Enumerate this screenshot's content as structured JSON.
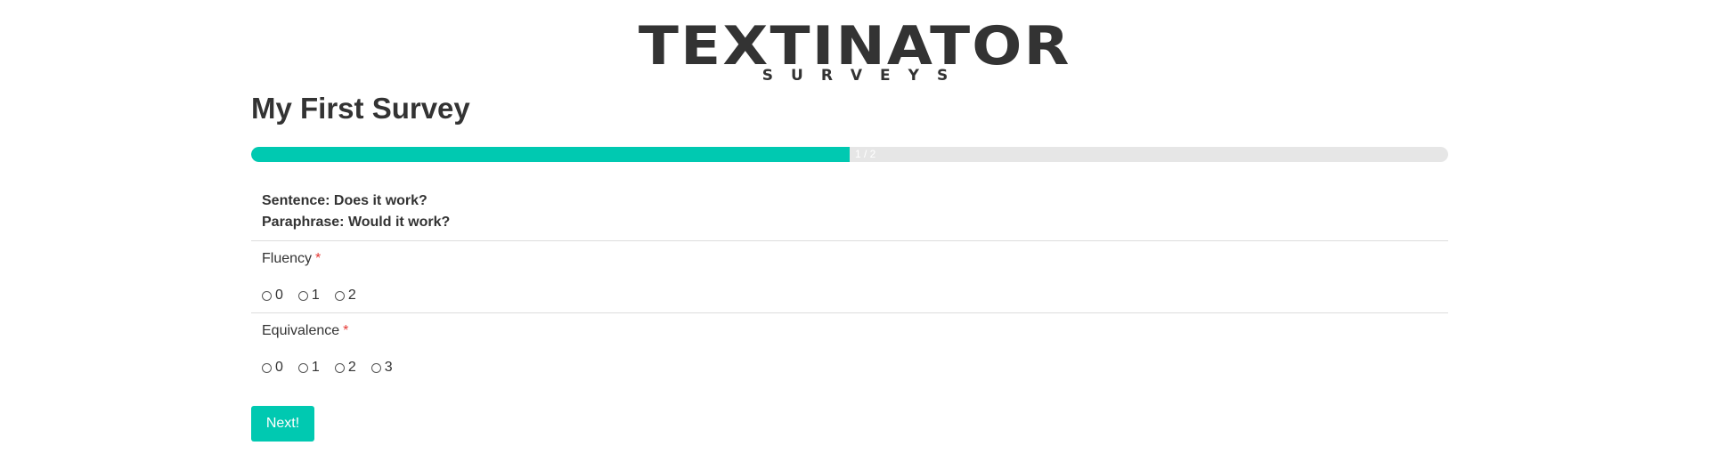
{
  "logo": {
    "title": "TEXTINATOR",
    "subtitle": "SURVEYS"
  },
  "survey": {
    "title": "My First Survey"
  },
  "progress": {
    "text": "1 / 2",
    "fraction": 0.5
  },
  "item": {
    "sentence": "Sentence: Does it work?",
    "paraphrase": "Paraphrase: Would it work?"
  },
  "questions": [
    {
      "label": "Fluency",
      "required_mark": "*",
      "options": [
        "0",
        "1",
        "2"
      ]
    },
    {
      "label": "Equivalence",
      "required_mark": "*",
      "options": [
        "0",
        "1",
        "2",
        "3"
      ]
    }
  ],
  "next_button": {
    "label": "Next!"
  },
  "colors": {
    "accent": "#00c9b1",
    "required": "#e53935",
    "text": "#333333"
  }
}
